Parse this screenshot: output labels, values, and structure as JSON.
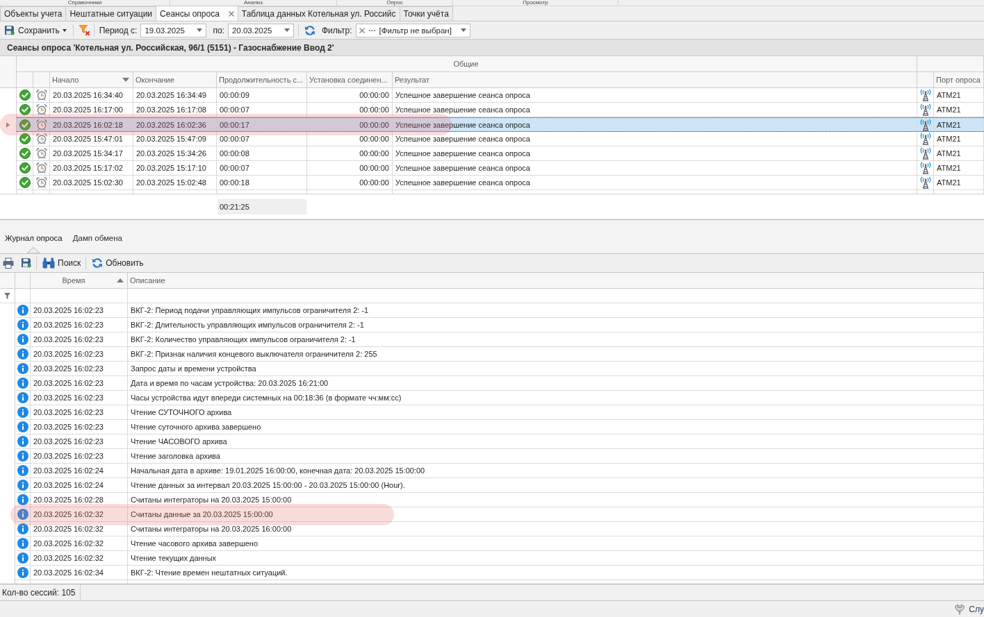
{
  "ribbon_groups": [
    "Справочники",
    "Анализ",
    "Опрос",
    "Просмотр"
  ],
  "tabs": [
    {
      "label": "Объекты учета",
      "selected": false
    },
    {
      "label": "Нештатные ситуации",
      "selected": false
    },
    {
      "label": "Сеансы опроса",
      "selected": true
    },
    {
      "label": "Таблица данных Котельная ул. Российс",
      "selected": false
    },
    {
      "label": "Точки учёта",
      "selected": false
    }
  ],
  "toolbar": {
    "save": "Сохранить",
    "period_from_label": "Период с:",
    "period_from": "19.03.2025",
    "period_to_label": "по:",
    "period_to": "20.03.2025",
    "filter_label": "Фильтр:",
    "filter_value": "[Фильтр не выбран]"
  },
  "title": "Сеансы опроса 'Котельная ул. Российская, 96/1 (5151) - Газоснабжение Ввод 2'",
  "sessions": {
    "band": "Общие",
    "columns": [
      {
        "label": "Начало",
        "sort_ascending": false,
        "sort_descending": true
      },
      {
        "label": "Окончание",
        "sort_ascending": false,
        "sort_descending": false
      },
      {
        "label": "Продолжительность с...",
        "sort_ascending": false,
        "sort_descending": false
      },
      {
        "label": "Установка соединен...",
        "sort_ascending": false,
        "sort_descending": false
      },
      {
        "label": "Результат",
        "sort_ascending": false,
        "sort_descending": false
      },
      {
        "label": "Порт опроса",
        "sort_ascending": false,
        "sort_descending": false
      }
    ],
    "rows": [
      {
        "start": "20.03.2025 16:34:40",
        "end": "20.03.2025 16:34:49",
        "duration": "00:00:09",
        "connection": "00:00:00",
        "result": "Успешное завершение сеанса опроса",
        "port": "ATM21",
        "selected": false,
        "highlighted": false
      },
      {
        "start": "20.03.2025 16:17:00",
        "end": "20.03.2025 16:17:08",
        "duration": "00:00:07",
        "connection": "00:00:00",
        "result": "Успешное завершение сеанса опроса",
        "port": "ATM21",
        "selected": false,
        "highlighted": false
      },
      {
        "start": "20.03.2025 16:02:18",
        "end": "20.03.2025 16:02:36",
        "duration": "00:00:17",
        "connection": "00:00:00",
        "result": "Успешное завершение сеанса опроса",
        "port": "ATM21",
        "selected": true,
        "highlighted": true
      },
      {
        "start": "20.03.2025 15:47:01",
        "end": "20.03.2025 15:47:09",
        "duration": "00:00:07",
        "connection": "00:00:00",
        "result": "Успешное завершение сеанса опроса",
        "port": "ATM21",
        "selected": false,
        "highlighted": false
      },
      {
        "start": "20.03.2025 15:34:17",
        "end": "20.03.2025 15:34:26",
        "duration": "00:00:08",
        "connection": "00:00:00",
        "result": "Успешное завершение сеанса опроса",
        "port": "ATM21",
        "selected": false,
        "highlighted": false
      },
      {
        "start": "20.03.2025 15:17:02",
        "end": "20.03.2025 15:17:10",
        "duration": "00:00:07",
        "connection": "00:00:00",
        "result": "Успешное завершение сеанса опроса",
        "port": "ATM21",
        "selected": false,
        "highlighted": false
      },
      {
        "start": "20.03.2025 15:02:30",
        "end": "20.03.2025 15:02:48",
        "duration": "00:00:18",
        "connection": "00:00:00",
        "result": "Успешное завершение сеанса опроса",
        "port": "ATM21",
        "selected": false,
        "highlighted": false
      }
    ],
    "total_duration": "00:21:25"
  },
  "log_tabs": [
    {
      "label": "Журнал опроса",
      "selected": true
    },
    {
      "label": "Дамп обмена",
      "selected": false
    }
  ],
  "log_toolbar": {
    "search": "Поиск",
    "refresh": "Обновить"
  },
  "log": {
    "columns": [
      {
        "label": "Время",
        "sort_ascending": true,
        "sort_descending": false
      },
      {
        "label": "Описание",
        "sort_ascending": false,
        "sort_descending": false
      }
    ],
    "rows": [
      {
        "time": "20.03.2025 16:02:23",
        "description": "ВКГ-2: Период подачи управляющих импульсов ограничителя 2: -1",
        "highlighted": false
      },
      {
        "time": "20.03.2025 16:02:23",
        "description": "ВКГ-2: Длительность управляющих импульсов ограничителя 2: -1",
        "highlighted": false
      },
      {
        "time": "20.03.2025 16:02:23",
        "description": "ВКГ-2: Количество управляющих импульсов ограничителя 2: -1",
        "highlighted": false
      },
      {
        "time": "20.03.2025 16:02:23",
        "description": "ВКГ-2: Признак наличия концевого выключателя ограничителя 2: 255",
        "highlighted": false
      },
      {
        "time": "20.03.2025 16:02:23",
        "description": "Запрос даты и времени устройства",
        "highlighted": false
      },
      {
        "time": "20.03.2025 16:02:23",
        "description": "Дата и время по часам устройства: 20.03.2025 16:21:00",
        "highlighted": false
      },
      {
        "time": "20.03.2025 16:02:23",
        "description": "Часы устройства идут впереди системных на 00:18:36 (в формате чч:мм:сс)",
        "highlighted": false
      },
      {
        "time": "20.03.2025 16:02:23",
        "description": "Чтение СУТОЧНОГО архива",
        "highlighted": false
      },
      {
        "time": "20.03.2025 16:02:23",
        "description": "Чтение суточного архива завершено",
        "highlighted": false
      },
      {
        "time": "20.03.2025 16:02:23",
        "description": "Чтение ЧАСОВОГО архива",
        "highlighted": false
      },
      {
        "time": "20.03.2025 16:02:23",
        "description": "Чтение заголовка архива",
        "highlighted": false
      },
      {
        "time": "20.03.2025 16:02:24",
        "description": "Начальная дата в архиве: 19.01.2025 16:00:00, конечная дата: 20.03.2025 15:00:00",
        "highlighted": false
      },
      {
        "time": "20.03.2025 16:02:24",
        "description": "Чтение данных за интервал 20.03.2025 15:00:00 - 20.03.2025 15:00:00 (Hour).",
        "highlighted": false
      },
      {
        "time": "20.03.2025 16:02:28",
        "description": "Считаны интеграторы на 20.03.2025 15:00:00",
        "highlighted": false
      },
      {
        "time": "20.03.2025 16:02:32",
        "description": "Считаны данные за 20.03.2025 15:00:00",
        "highlighted": true
      },
      {
        "time": "20.03.2025 16:02:32",
        "description": "Считаны интеграторы на 20.03.2025 16:00:00",
        "highlighted": false
      },
      {
        "time": "20.03.2025 16:02:32",
        "description": "Чтение часового архива завершено",
        "highlighted": false
      },
      {
        "time": "20.03.2025 16:02:32",
        "description": "Чтение текущих данных",
        "highlighted": false
      },
      {
        "time": "20.03.2025 16:02:34",
        "description": "ВКГ-2: Чтение времен нештатных ситуаций.",
        "highlighted": false
      }
    ]
  },
  "status": "Кол-во сессий: 105",
  "bottom_bar": "Слу"
}
